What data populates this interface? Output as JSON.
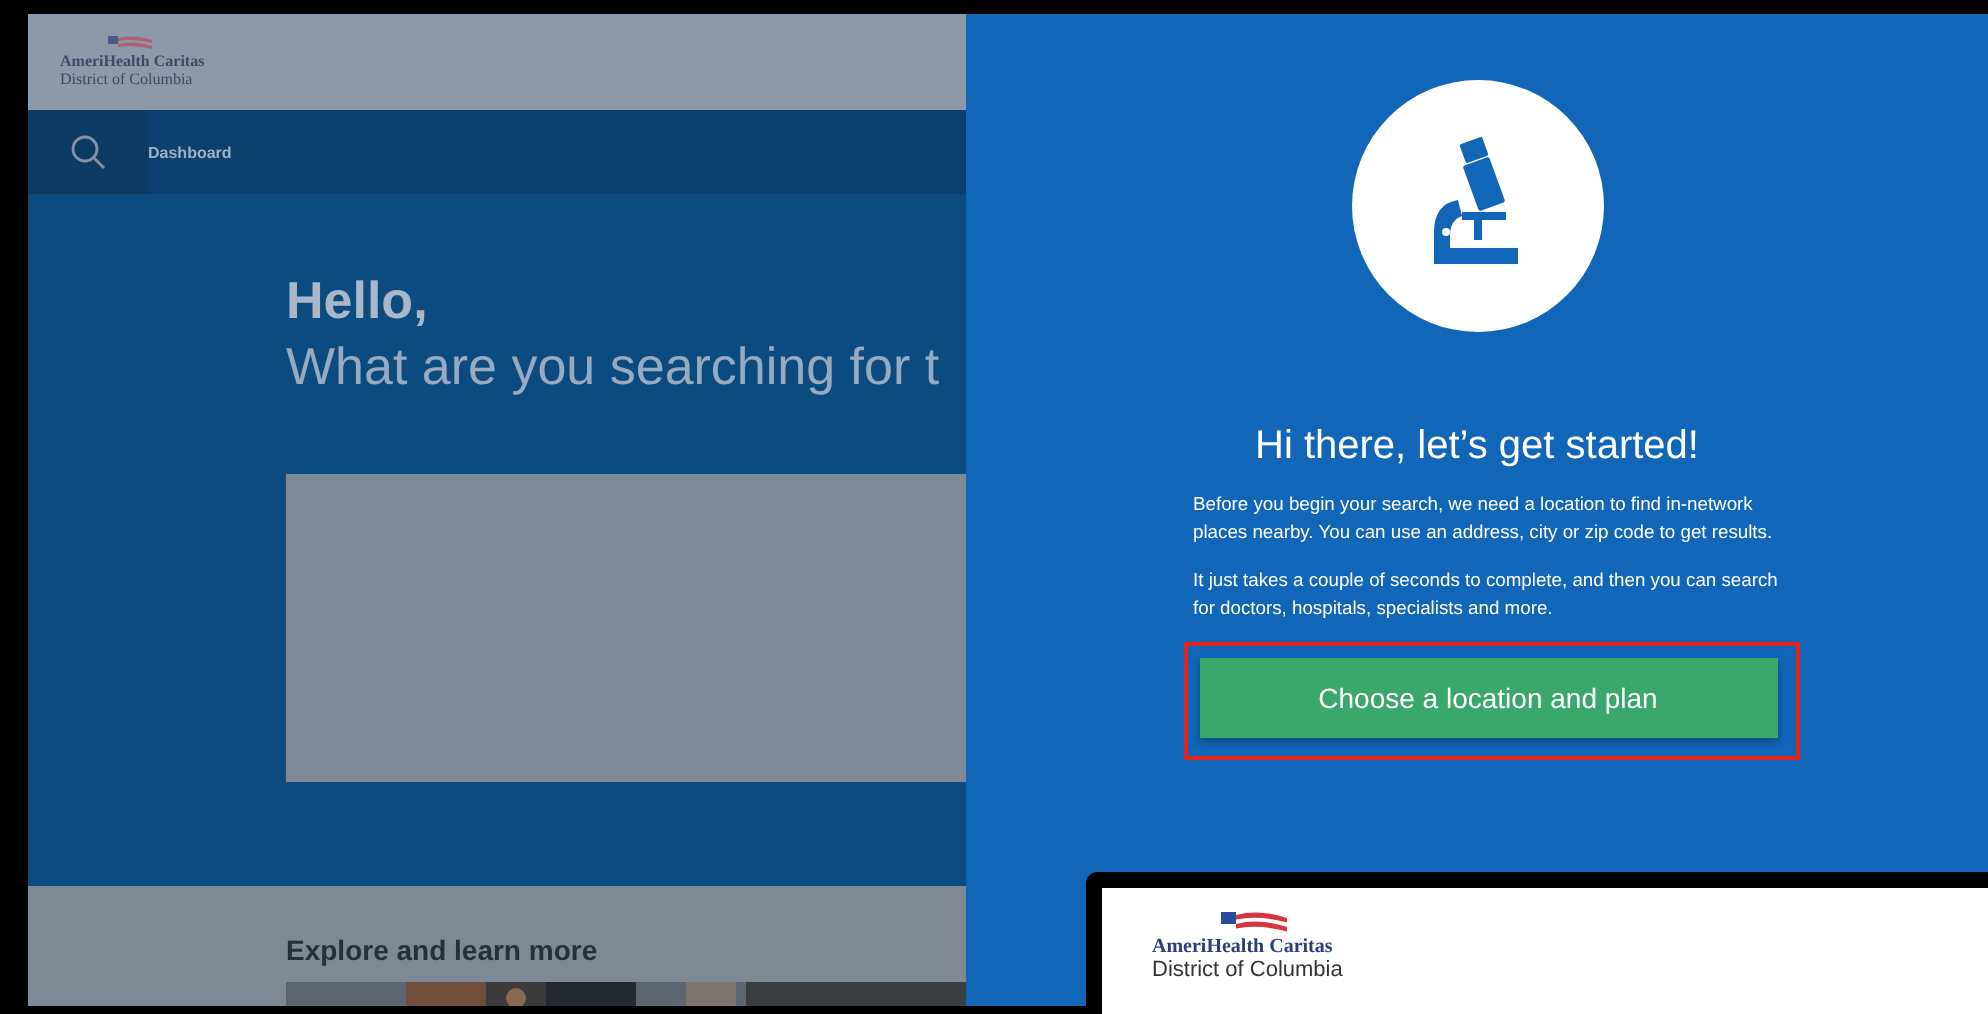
{
  "background_page": {
    "logo": {
      "brand": "AmeriHealth Caritas",
      "region": "District of Columbia"
    },
    "nav": {
      "item": "Dashboard"
    },
    "greeting": "Hello,",
    "prompt": "What are you searching for t",
    "section_title": "Explore and learn more"
  },
  "panel": {
    "title": "Hi there, let’s get started!",
    "paragraphs": [
      "Before you begin your search, we need a location to find in-network places nearby. You can use an address, city or zip code to get results.",
      "It just takes a couple of seconds to complete, and then you can search for doctors, hospitals, specialists and more."
    ],
    "button": {
      "label": "Choose a location and plan",
      "highlighted": true
    }
  },
  "inset": {
    "logo": {
      "brand": "AmeriHealth Caritas",
      "region": "District of Columbia"
    }
  }
}
